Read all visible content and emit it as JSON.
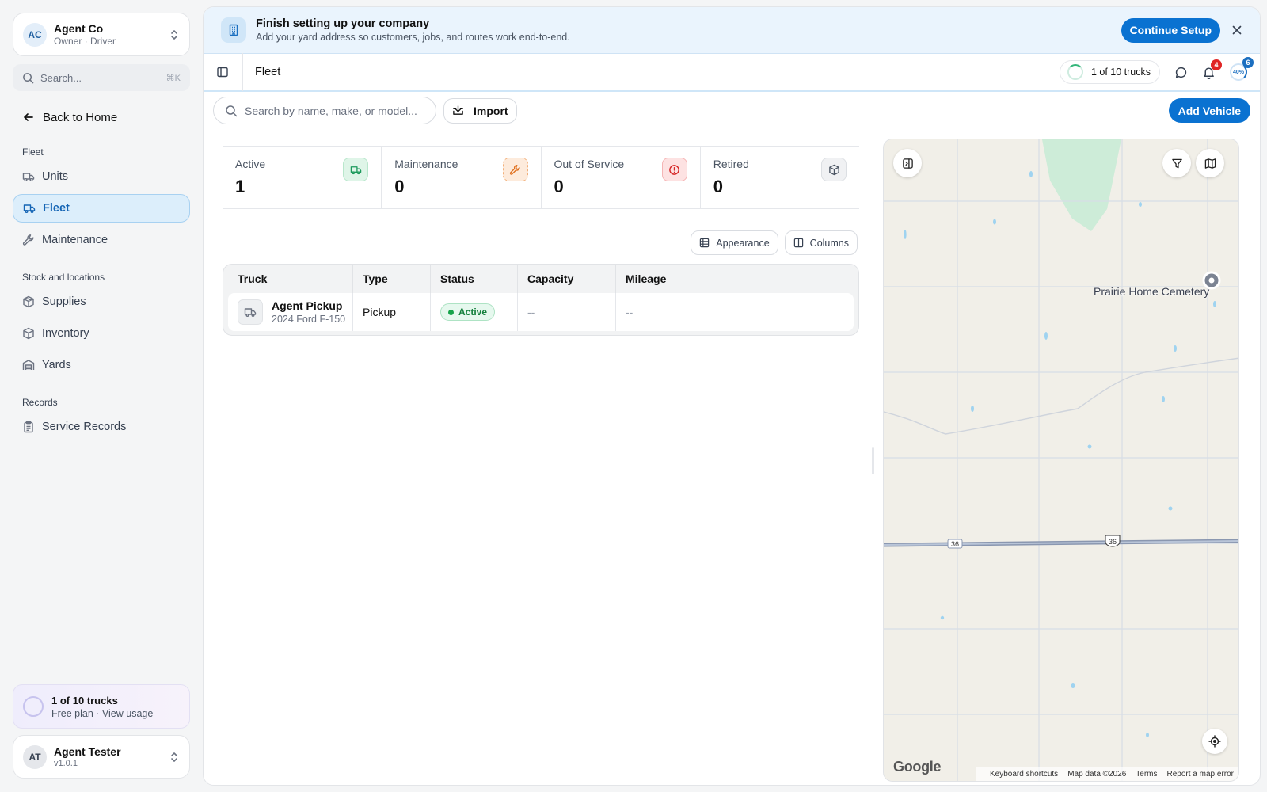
{
  "org": {
    "initials": "AC",
    "name": "Agent Co",
    "role": "Owner · Driver"
  },
  "search": {
    "label": "Search...",
    "shortcut": "⌘K"
  },
  "back": "Back to Home",
  "nav": {
    "fleet_label": "Fleet",
    "units": "Units",
    "fleet": "Fleet",
    "maintenance": "Maintenance",
    "stock_label": "Stock and locations",
    "supplies": "Supplies",
    "inventory": "Inventory",
    "yards": "Yards",
    "records_label": "Records",
    "service_records": "Service Records"
  },
  "usage": {
    "title": "1 of 10 trucks",
    "sub": "Free plan · View usage"
  },
  "user": {
    "initials": "AT",
    "name": "Agent Tester",
    "version": "v1.0.1"
  },
  "banner": {
    "title": "Finish setting up your company",
    "sub": "Add your yard address so customers, jobs, and routes work end-to-end.",
    "cta": "Continue Setup"
  },
  "topbar": {
    "title": "Fleet",
    "trucks": "1 of 10 trucks",
    "notif_count": "4",
    "progress_count": "6",
    "progress_pct": "40%"
  },
  "toolbar": {
    "search_placeholder": "Search by name, make, or model...",
    "import": "Import",
    "add": "Add Vehicle"
  },
  "stats": [
    {
      "label": "Active",
      "value": "1"
    },
    {
      "label": "Maintenance",
      "value": "0"
    },
    {
      "label": "Out of Service",
      "value": "0"
    },
    {
      "label": "Retired",
      "value": "0"
    }
  ],
  "table_tools": {
    "appearance": "Appearance",
    "columns": "Columns"
  },
  "table": {
    "headers": [
      "Truck",
      "Type",
      "Status",
      "Capacity",
      "Mileage"
    ],
    "rows": [
      {
        "name": "Agent Pickup",
        "model": "2024 Ford F-150",
        "type": "Pickup",
        "status": "Active",
        "capacity": "--",
        "mileage": "--"
      }
    ]
  },
  "map": {
    "place": "Prairie Home Cemetery",
    "route_a": "36",
    "route_b": "36",
    "brand": "Google",
    "footer": [
      "Keyboard shortcuts",
      "Map data ©2026",
      "Terms",
      "Report a map error"
    ]
  }
}
